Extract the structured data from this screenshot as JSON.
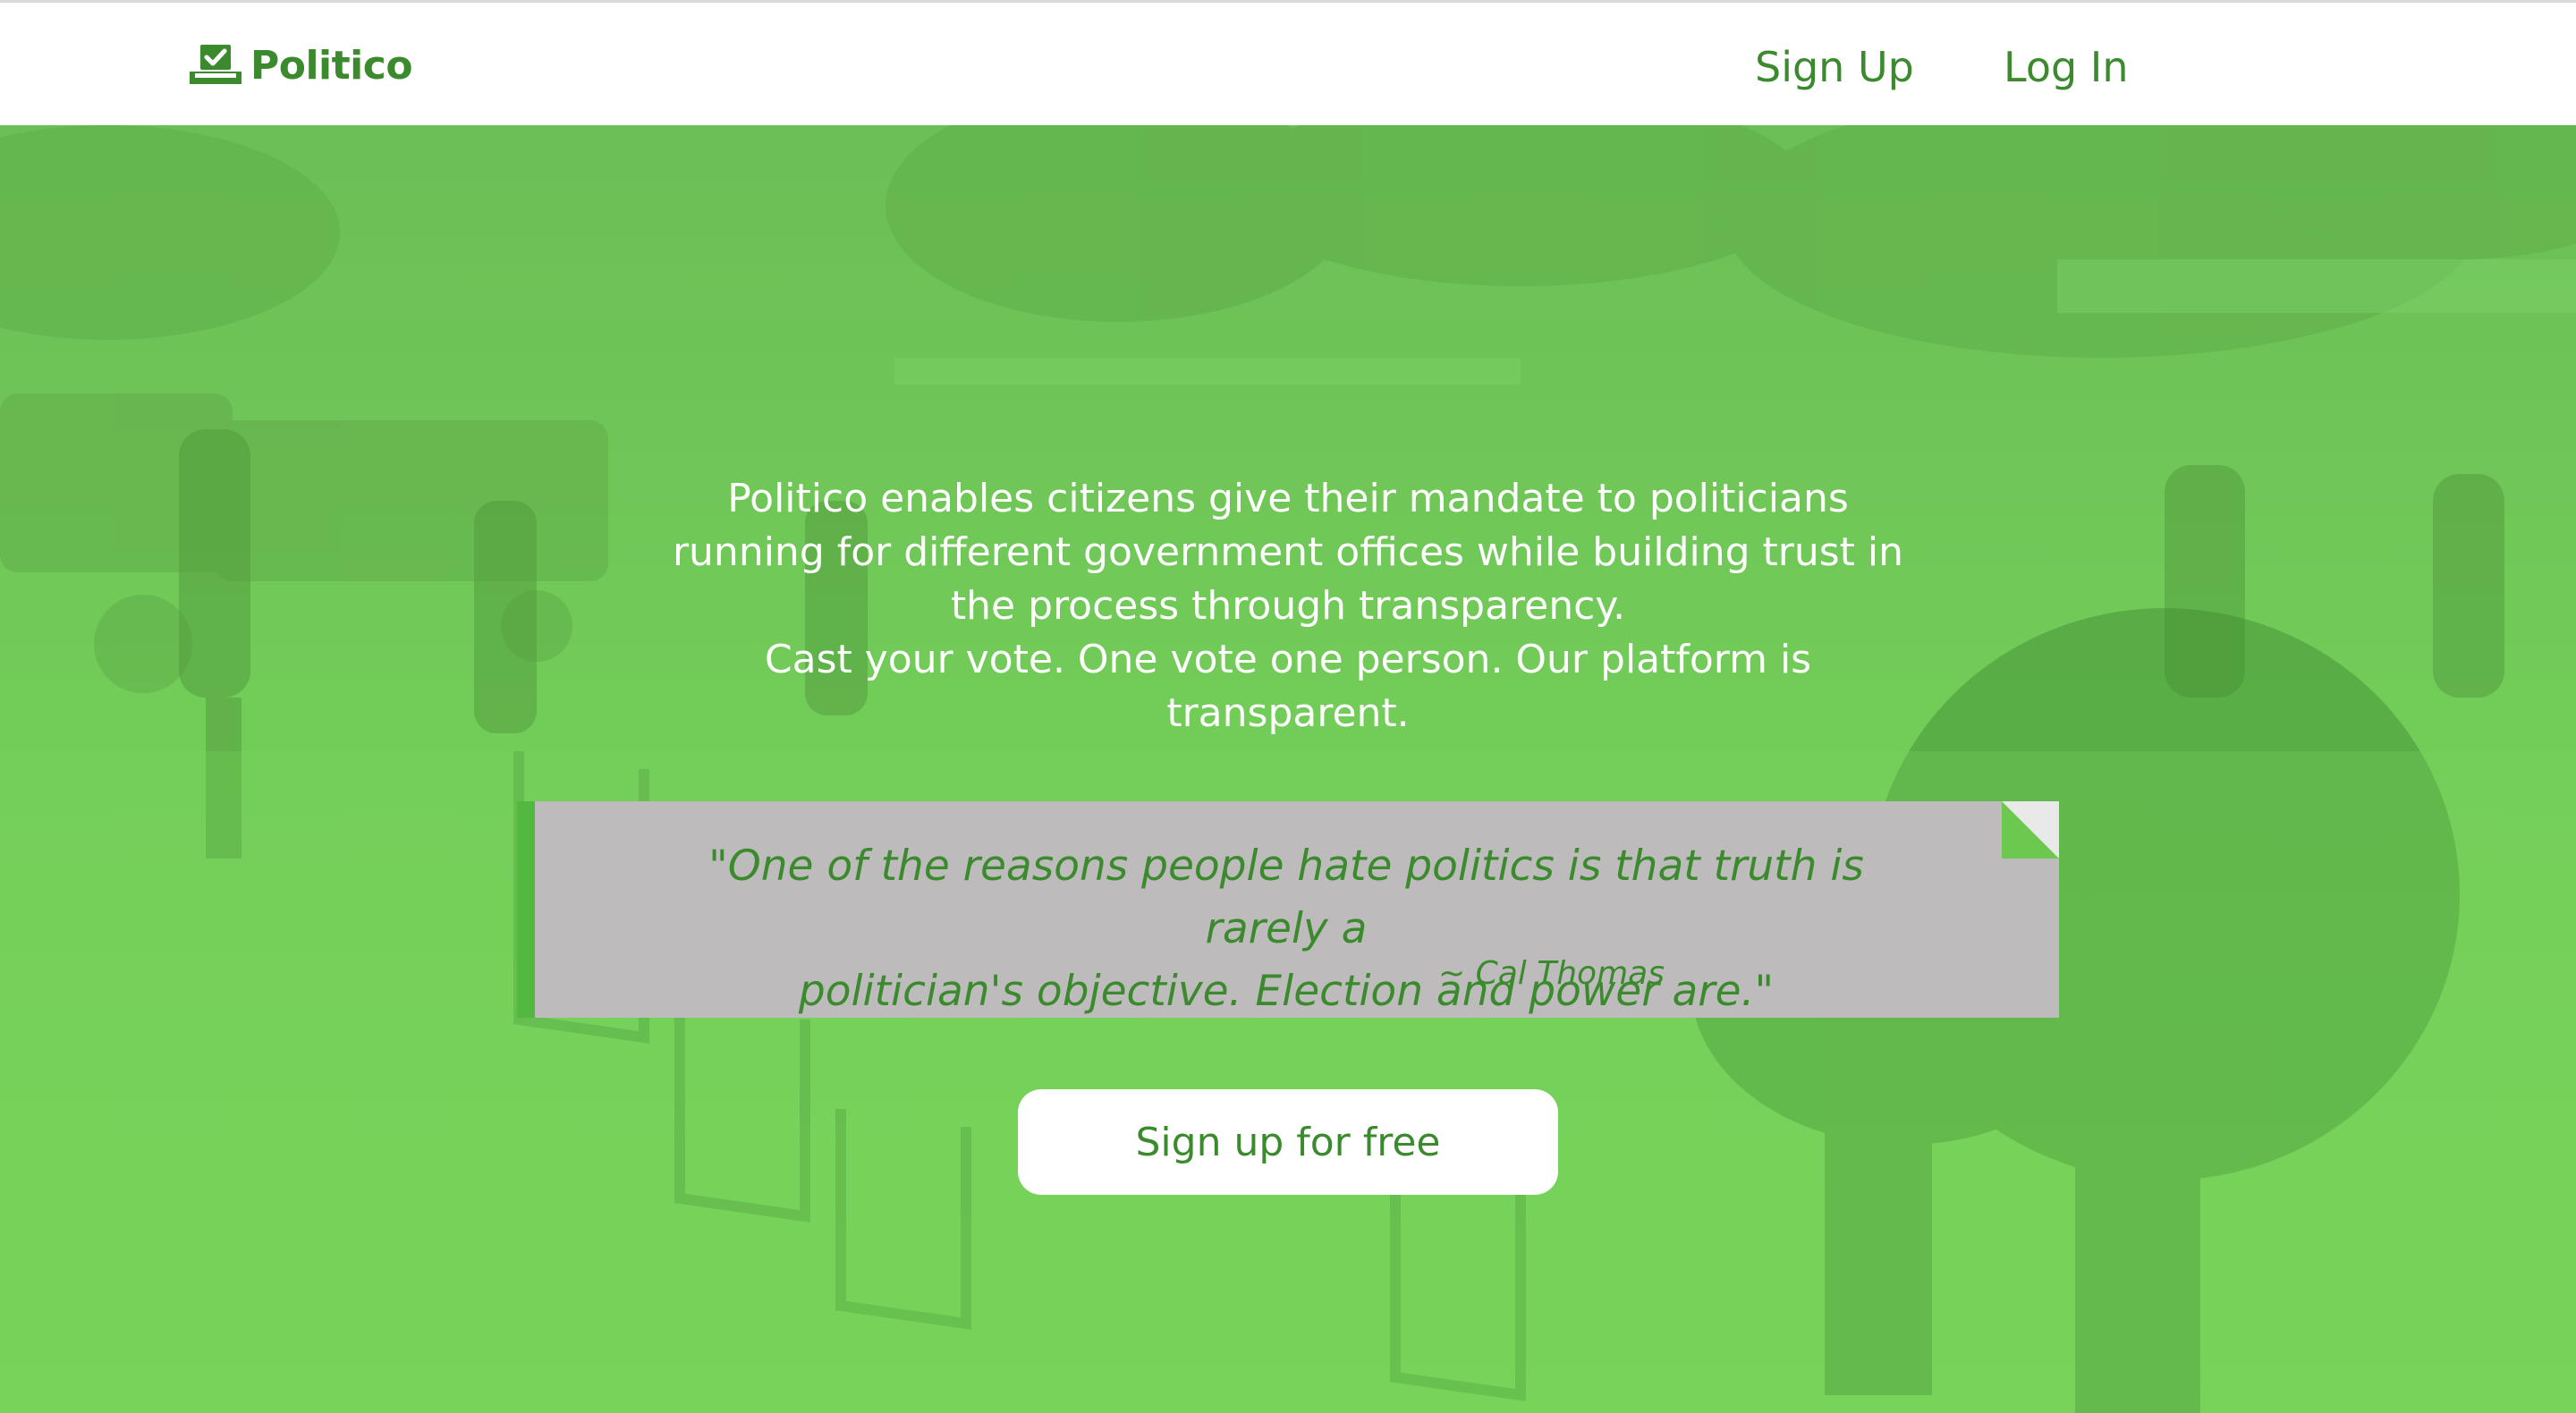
{
  "header": {
    "brand": "Politico",
    "brand_icon": "ballot-box-icon",
    "nav": {
      "signup_label": "Sign Up",
      "login_label": "Log In"
    }
  },
  "hero": {
    "description_lines": [
      "Politico enables citizens give their mandate to politicians",
      "running for different government offices while building trust in",
      "the process through transparency.",
      "Cast your vote. One vote one person. Our platform is",
      "transparent."
    ],
    "quote": {
      "lines": [
        "\"One of the reasons people hate politics is that truth is rarely a",
        "politician's objective. Election and power are.\""
      ],
      "author": "~ Cal Thomas"
    },
    "cta_label": "Sign up for free"
  },
  "colors": {
    "brand_green": "#3c8a2e",
    "hero_overlay_green": "#6cc84f",
    "quote_background": "#bebbbc",
    "quote_accent": "#52b83f",
    "header_background": "#ffffff"
  }
}
